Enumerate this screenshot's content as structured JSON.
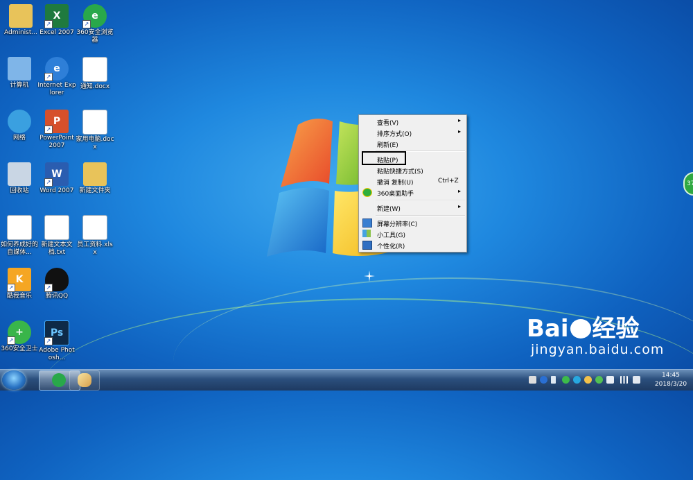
{
  "desktop": {
    "icons": [
      {
        "label": "Administ...",
        "icon": "user-folder-icon",
        "color": "#e8c35a"
      },
      {
        "label": "Excel 2007",
        "icon": "excel-icon",
        "color": "#1f7a3e"
      },
      {
        "label": "360安全浏览器",
        "icon": "browser-360-icon",
        "color": "#29a84a"
      },
      {
        "label": "计算机",
        "icon": "computer-icon",
        "color": "#7fb5e8"
      },
      {
        "label": "Internet Explorer",
        "icon": "ie-icon",
        "color": "#2e7fd8"
      },
      {
        "label": "通知.docx",
        "icon": "document-icon",
        "color": "#ffffff"
      },
      {
        "label": "网络",
        "icon": "network-icon",
        "color": "#3aa0e0"
      },
      {
        "label": "PowerPoint 2007",
        "icon": "powerpoint-icon",
        "color": "#d6502b"
      },
      {
        "label": "家用电脑.docx",
        "icon": "document-icon",
        "color": "#ffffff"
      },
      {
        "label": "回收站",
        "icon": "recycle-bin-icon",
        "color": "#c9d6e4"
      },
      {
        "label": "Word 2007",
        "icon": "word-icon",
        "color": "#2a5db0"
      },
      {
        "label": "新建文件夹",
        "icon": "folder-icon",
        "color": "#e8c35a"
      },
      {
        "label": "如何养成好的自媒体...",
        "icon": "document-icon",
        "color": "#ffffff"
      },
      {
        "label": "新建文本文档.txt",
        "icon": "text-file-icon",
        "color": "#ffffff"
      },
      {
        "label": "员工资料.xlsx",
        "icon": "excel-file-icon",
        "color": "#ffffff"
      },
      {
        "label": "酷我音乐",
        "icon": "kuwo-music-icon",
        "color": "#f5a623"
      },
      {
        "label": "腾讯QQ",
        "icon": "qq-penguin-icon",
        "color": "#111111"
      },
      {
        "label": "360安全卫士",
        "icon": "360-security-icon",
        "color": "#39b54a"
      },
      {
        "label": "Adobe Photosh...",
        "icon": "photoshop-icon",
        "color": "#0e2a47"
      }
    ]
  },
  "context_menu": {
    "items": [
      {
        "label": "查看(V)",
        "submenu": true
      },
      {
        "label": "排序方式(O)",
        "submenu": true
      },
      {
        "label": "刷新(E)"
      },
      {
        "label": "粘贴(P)"
      },
      {
        "label": "粘贴快捷方式(S)"
      },
      {
        "label": "撤消 复制(U)",
        "shortcut": "Ctrl+Z"
      },
      {
        "label": "360桌面助手",
        "submenu": true,
        "icon": "360-assistant-icon"
      },
      {
        "label": "新建(W)",
        "submenu": true
      },
      {
        "label": "屏幕分辨率(C)",
        "icon": "display-icon"
      },
      {
        "label": "小工具(G)",
        "icon": "gadgets-icon"
      },
      {
        "label": "个性化(R)",
        "icon": "personalize-icon"
      }
    ],
    "submenu_glyph": "▸"
  },
  "taskbar": {
    "clock_time": "14:45",
    "clock_date": "2018/3/20",
    "pinned": [
      "browser-360-icon",
      "paint-icon"
    ]
  },
  "side_widget": {
    "text": "37"
  },
  "watermark": {
    "brand": "Bai",
    "brand_cn": "经验",
    "url": "jingyan.baidu.com"
  }
}
